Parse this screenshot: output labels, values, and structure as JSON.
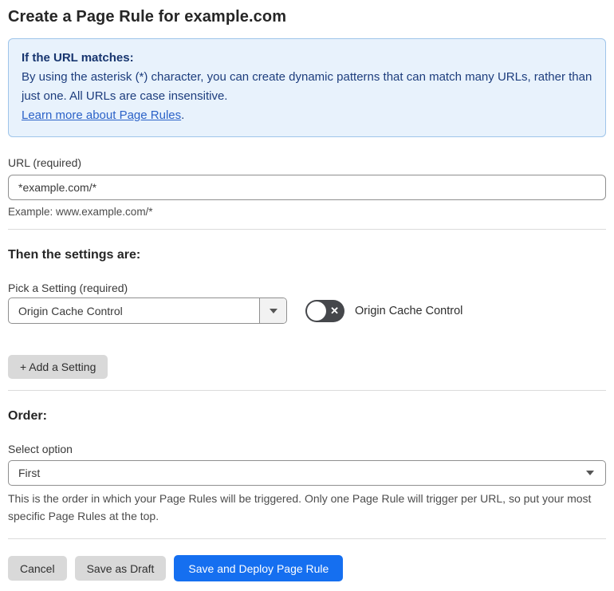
{
  "page": {
    "title": "Create a Page Rule for example.com"
  },
  "info_box": {
    "heading": "If the URL matches:",
    "body": "By using the asterisk (*) character, you can create dynamic patterns that can match many URLs, rather than just one. All URLs are case insensitive.",
    "link_label": "Learn more about Page Rules",
    "link_suffix": "."
  },
  "url_section": {
    "label": "URL (required)",
    "value": "*example.com/*",
    "example": "Example: www.example.com/*"
  },
  "settings_section": {
    "heading": "Then the settings are:",
    "pick_label": "Pick a Setting (required)",
    "selected_setting": "Origin Cache Control",
    "toggle_state": "off",
    "toggle_label": "Origin Cache Control",
    "add_button_label": "+ Add a Setting"
  },
  "order_section": {
    "heading": "Order:",
    "label": "Select option",
    "selected_option": "First",
    "help": "This is the order in which your Page Rules will be triggered. Only one Page Rule will trigger per URL, so put your most specific Page Rules at the top."
  },
  "footer": {
    "cancel_label": "Cancel",
    "save_draft_label": "Save as Draft",
    "save_deploy_label": "Save and Deploy Page Rule"
  },
  "colors": {
    "info_bg": "#e8f2fc",
    "info_border": "#9fc5ea",
    "info_text": "#1d3d7d",
    "link_blue": "#2b62c8",
    "primary_button_blue": "#156ff0",
    "toggle_track_gray": "#45474b",
    "gray_button": "#d9d9d9",
    "divider_gray": "#dcdcdc"
  },
  "icons": {
    "caret": "caret-down-icon",
    "toggle_off_glyph": "✕"
  }
}
